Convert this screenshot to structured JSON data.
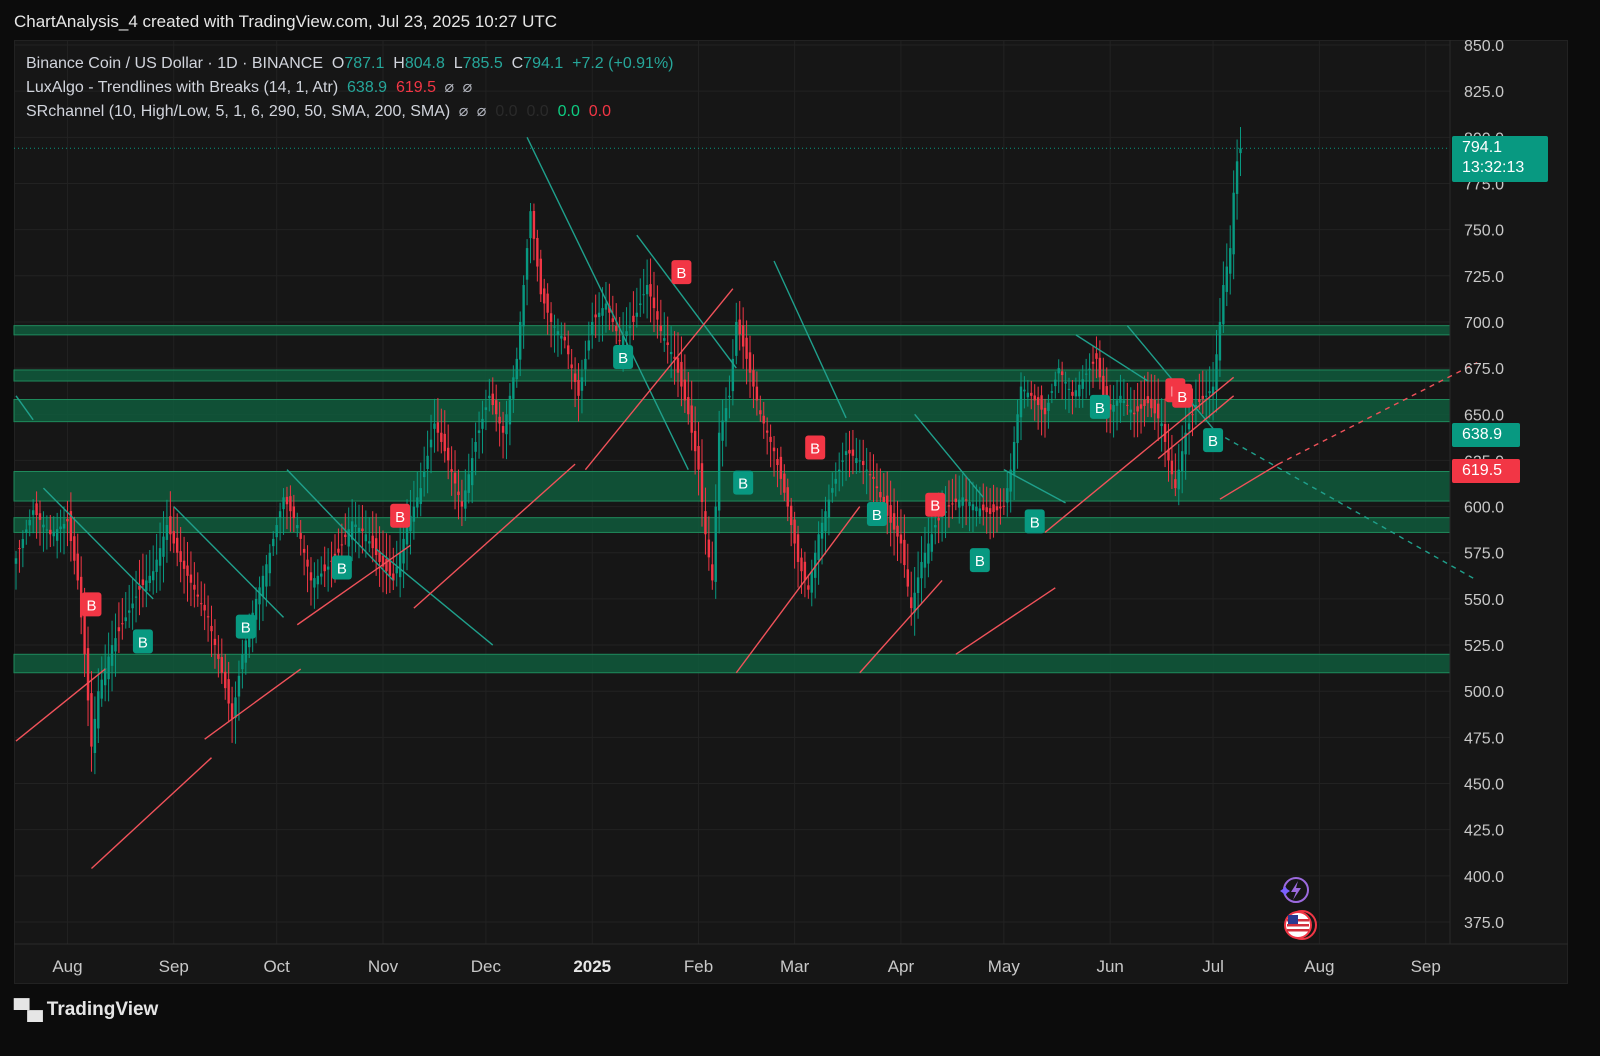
{
  "caption": "ChartAnalysis_4 created with TradingView.com, Jul 23, 2025 10:27 UTC",
  "legend": {
    "symbol": "Binance Coin / US Dollar · 1D · BINANCE",
    "o_label": "O",
    "o": "787.1",
    "h_label": "H",
    "h": "804.8",
    "l_label": "L",
    "l": "785.5",
    "c_label": "C",
    "c": "794.1",
    "change": "+7.2 (+0.91%)",
    "ind1_name": "LuxAlgo - Trendlines with Breaks (14, 1, Atr)",
    "ind1_v1": "638.9",
    "ind1_v2": "619.5",
    "ind2_name": "SRchannel (10, High/Low, 5, 1, 6, 290, 50, SMA, 200, SMA)",
    "ind2_v1": "0.0",
    "ind2_v2": "0.0",
    "ind2_v3": "0.0",
    "ind2_v4": "0.0",
    "null_symbol": "⌀"
  },
  "tags": {
    "last_price": "794.1",
    "countdown": "13:32:13",
    "upper_trend": "638.9",
    "lower_trend": "619.5"
  },
  "footer": {
    "brand": "TradingView",
    "logo_icon": "tradingview-logo-icon"
  },
  "colors": {
    "up": "#089981",
    "down": "#f23645",
    "zone": "#0f5a3c",
    "zone_edge": "#1f8a5c",
    "bg": "#161616"
  },
  "chart_data": {
    "type": "candlestick",
    "title": "Binance Coin / US Dollar · 1D · BINANCE",
    "ylim": [
      375,
      850
    ],
    "y_ticks": [
      375,
      400,
      425,
      450,
      475,
      500,
      525,
      550,
      575,
      600,
      625,
      650,
      675,
      700,
      725,
      750,
      775,
      800,
      825,
      850
    ],
    "x_ticks": [
      "Aug",
      "Sep",
      "Oct",
      "Nov",
      "Dec",
      "2025",
      "Feb",
      "Mar",
      "Apr",
      "May",
      "Jun",
      "Jul",
      "Aug",
      "Sep"
    ],
    "x_tick_days": [
      15,
      46,
      76,
      107,
      137,
      168,
      199,
      227,
      258,
      288,
      319,
      349,
      380,
      411
    ],
    "last_day": 357,
    "grid": true,
    "closes": [
      [
        0,
        572
      ],
      [
        5,
        598
      ],
      [
        10,
        585
      ],
      [
        15,
        592
      ],
      [
        18,
        560
      ],
      [
        20,
        520
      ],
      [
        22,
        470
      ],
      [
        24,
        500
      ],
      [
        28,
        525
      ],
      [
        32,
        540
      ],
      [
        36,
        555
      ],
      [
        40,
        565
      ],
      [
        44,
        590
      ],
      [
        48,
        570
      ],
      [
        52,
        555
      ],
      [
        56,
        540
      ],
      [
        60,
        510
      ],
      [
        63,
        485
      ],
      [
        66,
        520
      ],
      [
        70,
        550
      ],
      [
        74,
        575
      ],
      [
        78,
        605
      ],
      [
        82,
        590
      ],
      [
        86,
        560
      ],
      [
        90,
        565
      ],
      [
        94,
        575
      ],
      [
        98,
        592
      ],
      [
        102,
        585
      ],
      [
        106,
        570
      ],
      [
        110,
        560
      ],
      [
        114,
        590
      ],
      [
        118,
        610
      ],
      [
        122,
        645
      ],
      [
        126,
        625
      ],
      [
        130,
        600
      ],
      [
        134,
        635
      ],
      [
        138,
        660
      ],
      [
        142,
        640
      ],
      [
        146,
        680
      ],
      [
        150,
        760
      ],
      [
        153,
        715
      ],
      [
        156,
        700
      ],
      [
        160,
        690
      ],
      [
        164,
        660
      ],
      [
        168,
        700
      ],
      [
        172,
        710
      ],
      [
        176,
        690
      ],
      [
        180,
        700
      ],
      [
        184,
        720
      ],
      [
        188,
        695
      ],
      [
        192,
        680
      ],
      [
        196,
        650
      ],
      [
        199,
        620
      ],
      [
        201,
        585
      ],
      [
        203,
        560
      ],
      [
        205,
        640
      ],
      [
        208,
        660
      ],
      [
        210,
        700
      ],
      [
        213,
        680
      ],
      [
        217,
        650
      ],
      [
        221,
        630
      ],
      [
        225,
        600
      ],
      [
        228,
        570
      ],
      [
        231,
        555
      ],
      [
        234,
        585
      ],
      [
        238,
        610
      ],
      [
        242,
        630
      ],
      [
        246,
        625
      ],
      [
        250,
        615
      ],
      [
        254,
        595
      ],
      [
        258,
        580
      ],
      [
        261,
        545
      ],
      [
        264,
        570
      ],
      [
        268,
        590
      ],
      [
        272,
        600
      ],
      [
        276,
        605
      ],
      [
        280,
        600
      ],
      [
        284,
        596
      ],
      [
        288,
        600
      ],
      [
        290,
        620
      ],
      [
        293,
        665
      ],
      [
        296,
        660
      ],
      [
        300,
        650
      ],
      [
        304,
        675
      ],
      [
        308,
        660
      ],
      [
        312,
        672
      ],
      [
        315,
        680
      ],
      [
        318,
        650
      ],
      [
        322,
        660
      ],
      [
        326,
        650
      ],
      [
        330,
        656
      ],
      [
        334,
        645
      ],
      [
        336,
        625
      ],
      [
        338,
        610
      ],
      [
        341,
        640
      ],
      [
        344,
        655
      ],
      [
        347,
        660
      ],
      [
        349,
        665
      ],
      [
        351,
        700
      ],
      [
        352,
        720
      ],
      [
        354,
        740
      ],
      [
        355,
        770
      ],
      [
        356,
        787
      ],
      [
        357,
        794
      ]
    ],
    "zones": [
      [
        693,
        698
      ],
      [
        668,
        674
      ],
      [
        646,
        658
      ],
      [
        603,
        619
      ],
      [
        586,
        594
      ],
      [
        510,
        520
      ]
    ],
    "down_trendlines": [
      [
        [
          0,
          660
        ],
        [
          5,
          647
        ]
      ],
      [
        [
          8,
          610
        ],
        [
          40,
          550
        ]
      ],
      [
        [
          46,
          600
        ],
        [
          78,
          540
        ]
      ],
      [
        [
          79,
          620
        ],
        [
          110,
          560
        ]
      ],
      [
        [
          105,
          577
        ],
        [
          139,
          525
        ]
      ],
      [
        [
          149,
          800
        ],
        [
          196,
          620
        ]
      ],
      [
        [
          181,
          747
        ],
        [
          210,
          675
        ]
      ],
      [
        [
          221,
          733
        ],
        [
          242,
          648
        ]
      ],
      [
        [
          262,
          650
        ],
        [
          282,
          605
        ]
      ],
      [
        [
          288,
          620
        ],
        [
          306,
          602
        ]
      ],
      [
        [
          309,
          693
        ],
        [
          330,
          668
        ]
      ],
      [
        [
          324,
          698
        ],
        [
          350,
          640
        ]
      ]
    ],
    "down_trend_projection": [
      [
        350,
        640
      ],
      [
        426,
        560
      ]
    ],
    "up_trendlines": [
      [
        [
          0,
          473
        ],
        [
          26,
          512
        ]
      ],
      [
        [
          22,
          404
        ],
        [
          57,
          464
        ]
      ],
      [
        [
          55,
          474
        ],
        [
          83,
          512
        ]
      ],
      [
        [
          82,
          536
        ],
        [
          115,
          579
        ]
      ],
      [
        [
          116,
          545
        ],
        [
          163,
          623
        ]
      ],
      [
        [
          166,
          620
        ],
        [
          209,
          718
        ]
      ],
      [
        [
          210,
          510
        ],
        [
          246,
          600
        ]
      ],
      [
        [
          246,
          510
        ],
        [
          270,
          560
        ]
      ],
      [
        [
          274,
          520
        ],
        [
          303,
          556
        ]
      ],
      [
        [
          300,
          586
        ],
        [
          355,
          670
        ]
      ],
      [
        [
          333,
          626
        ],
        [
          355,
          660
        ]
      ],
      [
        [
          351,
          604
        ],
        [
          368,
          623
        ]
      ]
    ],
    "up_trend_projection": [
      [
        368,
        623
      ],
      [
        426,
        678
      ]
    ],
    "break_labels": [
      {
        "text": "B",
        "kind": "bearish",
        "day": 22,
        "price": 547
      },
      {
        "text": "B",
        "kind": "bullish",
        "day": 37,
        "price": 527
      },
      {
        "text": "B",
        "kind": "bullish",
        "day": 67,
        "price": 535
      },
      {
        "text": "B",
        "kind": "bullish",
        "day": 95,
        "price": 567
      },
      {
        "text": "B",
        "kind": "bearish",
        "day": 112,
        "price": 595
      },
      {
        "text": "B",
        "kind": "bullish",
        "day": 177,
        "price": 681
      },
      {
        "text": "B",
        "kind": "bearish",
        "day": 194,
        "price": 727
      },
      {
        "text": "B",
        "kind": "bullish",
        "day": 212,
        "price": 613
      },
      {
        "text": "B",
        "kind": "bearish",
        "day": 233,
        "price": 632
      },
      {
        "text": "B",
        "kind": "bullish",
        "day": 251,
        "price": 596
      },
      {
        "text": "B",
        "kind": "bearish",
        "day": 268,
        "price": 601
      },
      {
        "text": "B",
        "kind": "bullish",
        "day": 281,
        "price": 571
      },
      {
        "text": "B",
        "kind": "bullish",
        "day": 297,
        "price": 592
      },
      {
        "text": "B",
        "kind": "bullish",
        "day": 316,
        "price": 654
      },
      {
        "text": "B",
        "kind": "bearish",
        "day": 338,
        "price": 663
      },
      {
        "text": "B",
        "kind": "bearish",
        "day": 340,
        "price": 660
      },
      {
        "text": "B",
        "kind": "bullish",
        "day": 349,
        "price": 636
      }
    ]
  }
}
